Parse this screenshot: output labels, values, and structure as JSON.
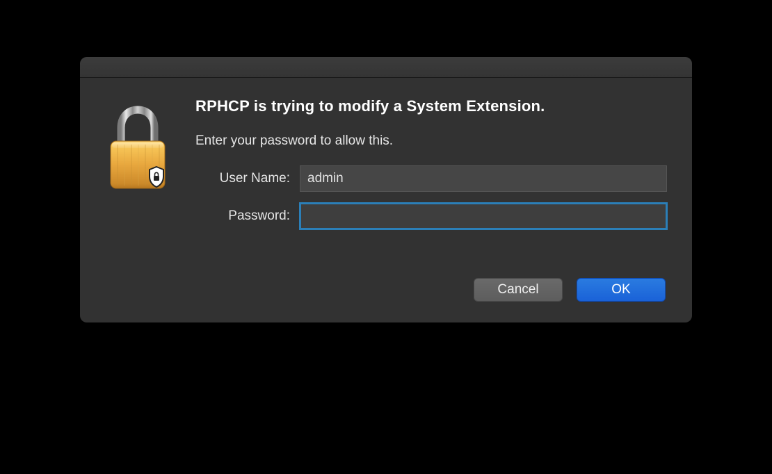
{
  "dialog": {
    "title": "RPHCP is trying to modify a System Extension.",
    "subtitle": "Enter your password to allow this.",
    "username_label": "User Name:",
    "username_value": "admin",
    "password_label": "Password:",
    "password_value": "",
    "cancel_label": "Cancel",
    "ok_label": "OK"
  }
}
